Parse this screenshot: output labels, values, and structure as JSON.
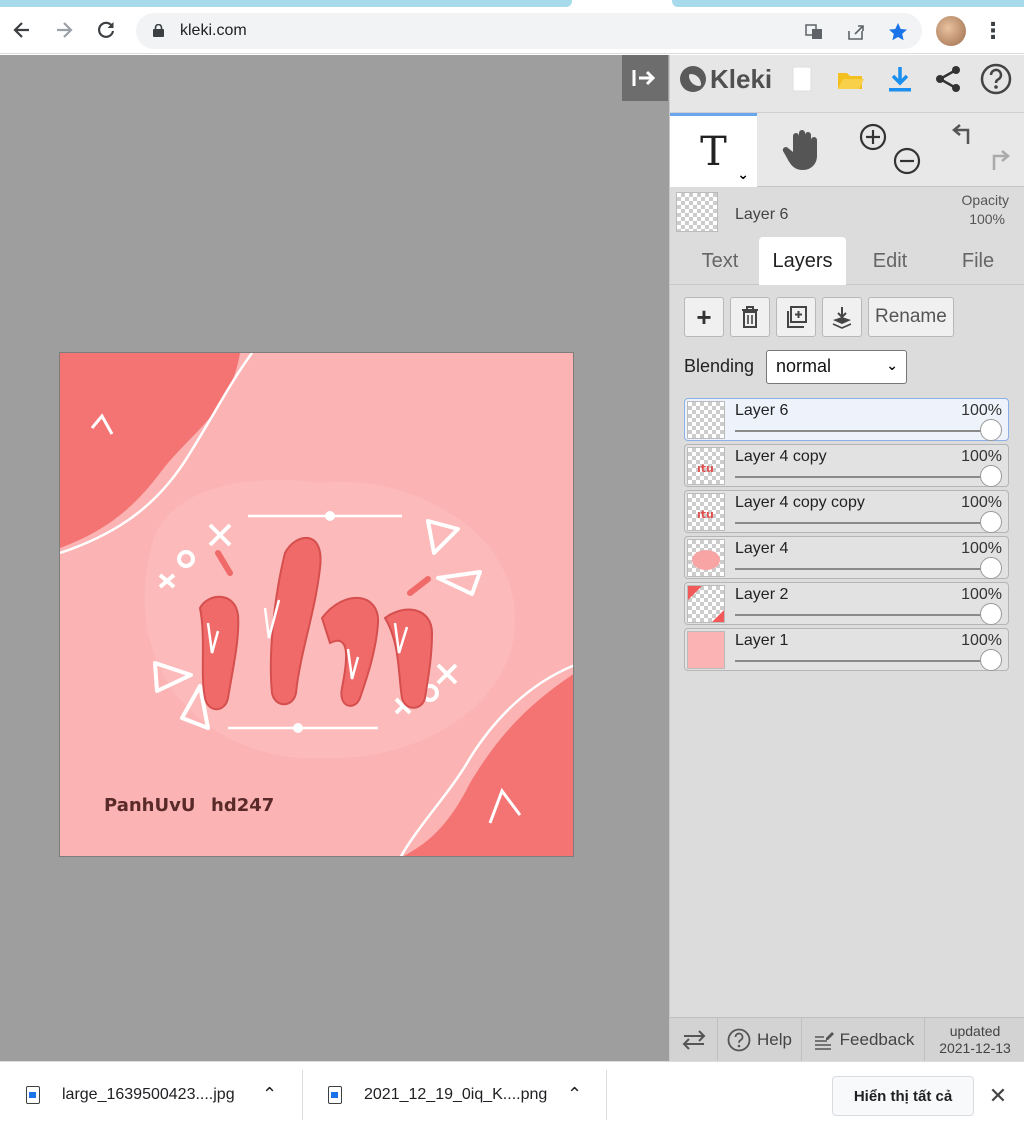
{
  "browser": {
    "url": "kleki.com",
    "back_icon": "arrow-left-icon",
    "forward_icon": "arrow-right-icon",
    "reload_icon": "reload-icon"
  },
  "app": {
    "name": "Kleki",
    "active_tool": "text",
    "current_layer": {
      "name": "Layer 6",
      "opacity_label": "Opacity",
      "opacity_value": "100%"
    },
    "tabs": [
      "Text",
      "Layers",
      "Edit",
      "File"
    ],
    "active_tab": "Layers",
    "actions": {
      "rename": "Rename"
    },
    "blending": {
      "label": "Blending",
      "value": "normal"
    },
    "layers": [
      {
        "name": "Layer 6",
        "opacity": "100%",
        "opacity_fraction": 1.0,
        "selected": true
      },
      {
        "name": "Layer 4 copy",
        "opacity": "100%",
        "opacity_fraction": 1.0,
        "selected": false
      },
      {
        "name": "Layer 4 copy copy",
        "opacity": "100%",
        "opacity_fraction": 1.0,
        "selected": false
      },
      {
        "name": "Layer 4",
        "opacity": "100%",
        "opacity_fraction": 1.0,
        "selected": false
      },
      {
        "name": "Layer 2",
        "opacity": "100%",
        "opacity_fraction": 1.0,
        "selected": false
      },
      {
        "name": "Layer 1",
        "opacity": "100%",
        "opacity_fraction": 1.0,
        "selected": false
      }
    ],
    "footer": {
      "help": "Help",
      "feedback": "Feedback",
      "updated_label": "updated",
      "updated_date": "2021-12-13"
    }
  },
  "canvas": {
    "signature_left": "PanhUvU",
    "signature_right": "hd247",
    "colors": {
      "background": "#fbb3b3",
      "accent": "#f47474",
      "lettering": "#f06a6a"
    }
  },
  "downloads": {
    "items": [
      "large_1639500423....jpg",
      "2021_12_19_0iq_K....png"
    ],
    "show_all": "Hiển thị tất cả"
  }
}
